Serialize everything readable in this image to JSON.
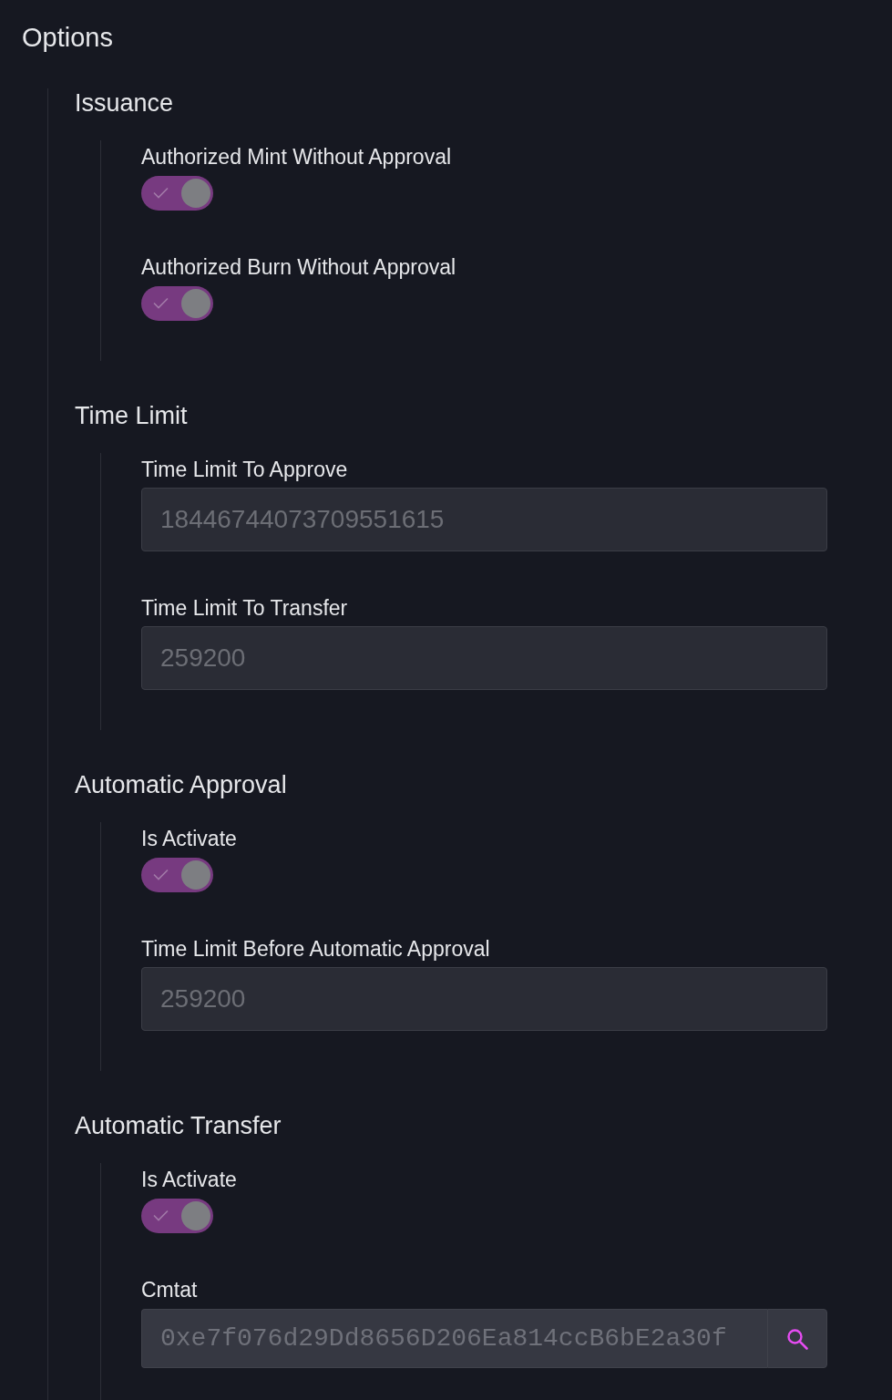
{
  "title": "Options",
  "sections": [
    {
      "title": "Issuance",
      "items": [
        {
          "kind": "toggle",
          "label": "Authorized Mint Without Approval",
          "checked": true
        },
        {
          "kind": "toggle",
          "label": "Authorized Burn Without Approval",
          "checked": true
        }
      ]
    },
    {
      "title": "Time Limit",
      "items": [
        {
          "kind": "field",
          "label": "Time Limit To Approve",
          "value": "18446744073709551615"
        },
        {
          "kind": "field",
          "label": "Time Limit To Transfer",
          "value": "259200"
        }
      ]
    },
    {
      "title": "Automatic Approval",
      "items": [
        {
          "kind": "toggle",
          "label": "Is Activate",
          "checked": true
        },
        {
          "kind": "field",
          "label": "Time Limit Before Automatic Approval",
          "value": "259200"
        }
      ]
    },
    {
      "title": "Automatic Transfer",
      "items": [
        {
          "kind": "toggle",
          "label": "Is Activate",
          "checked": true
        },
        {
          "kind": "search_field",
          "label": "Cmtat",
          "value": "0xe7f076d29Dd8656D206Ea814ccB6bE2a30f"
        }
      ]
    }
  ]
}
